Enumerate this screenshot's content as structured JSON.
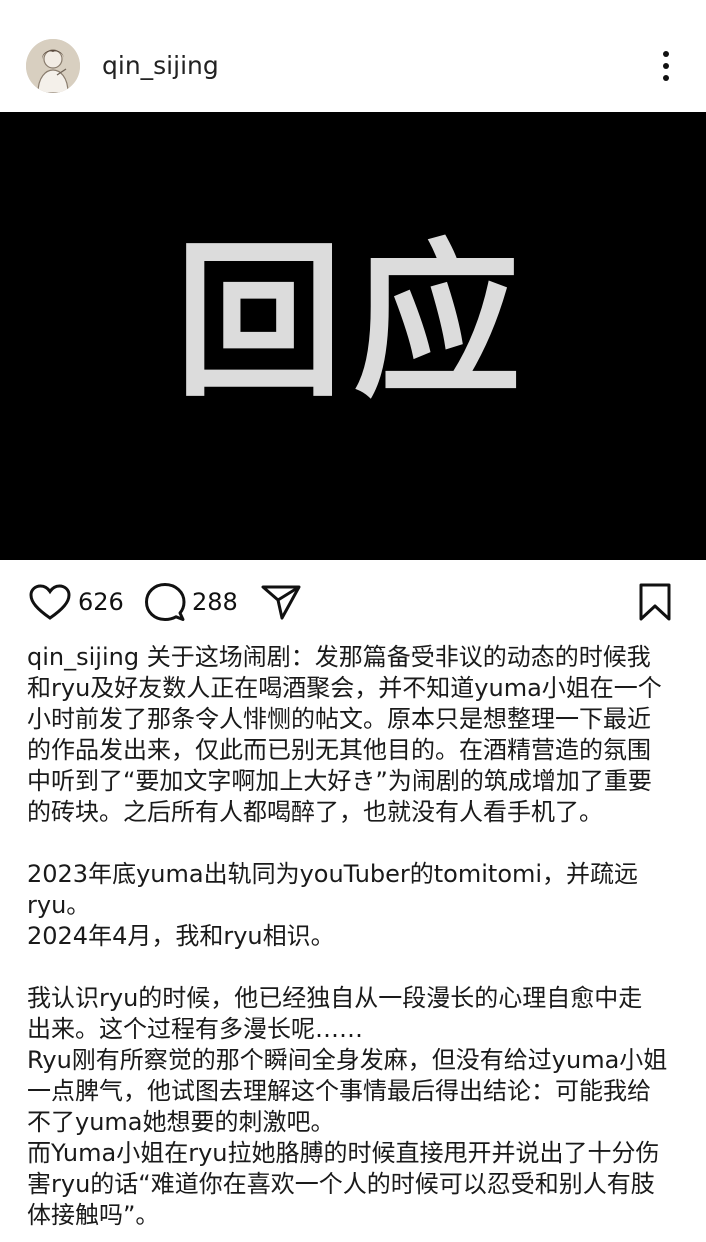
{
  "post": {
    "username": "qin_sijing",
    "image_text": "回应",
    "likes": "626",
    "comments": "288",
    "caption_user": "qin_sijing",
    "caption_lines": [
      "关于这场闹剧：发那篇备受非议的动态的时候我",
      "和ryu及好友数人正在喝酒聚会，并不知道yuma小姐在一个",
      "小时前发了那条令人悱恻的帖文。原本只是想整理一下最近",
      "的作品发出来，仅此而已别无其他目的。在酒精营造的氛围",
      "中听到了“要加文字啊加上大好き”为闹剧的筑成增加了重要",
      "的砖块。之后所有人都喝醉了，也就没有人看手机了。",
      "",
      "2023年底yuma出轨同为youTuber的tomitomi，并疏远ryu。",
      "2024年4月，我和ryu相识。",
      "",
      "我认识ryu的时候，他已经独自从一段漫长的心理自愈中走",
      "出来。这个过程有多漫长呢……",
      "Ryu刚有所察觉的那个瞬间全身发麻，但没有给过yuma小姐",
      "一点脾气，他试图去理解这个事情最后得出结论：可能我给",
      "不了yuma她想要的刺激吧。",
      "而Yuma小姐在ryu拉她胳膊的时候直接甩开并说出了十分伤",
      "害ryu的话“难道你在喜欢一个人的时候可以忍受和别人有肢",
      "体接触吗”。"
    ]
  },
  "icons": {
    "avatar": "profile-avatar",
    "more": "more-vertical-icon",
    "like": "heart-icon",
    "comment": "comment-bubble-icon",
    "share": "send-icon",
    "save": "bookmark-icon"
  }
}
